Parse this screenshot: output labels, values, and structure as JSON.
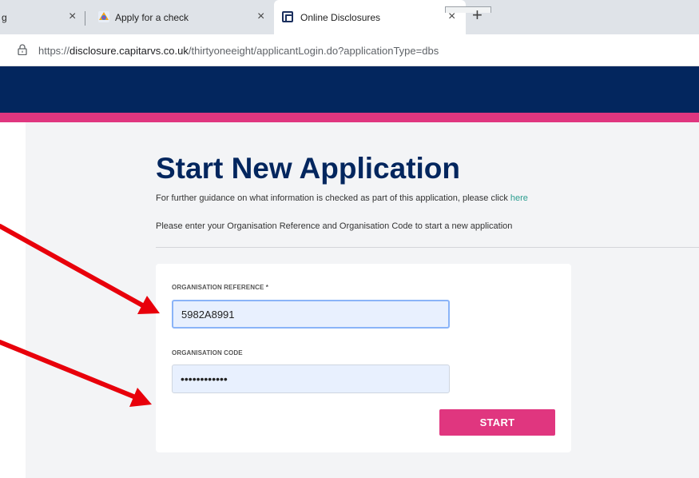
{
  "browser": {
    "tabs": [
      {
        "label": "g",
        "close": "×"
      },
      {
        "label": "Apply for a check",
        "close": "×"
      },
      {
        "label": "Online Disclosures",
        "close": "×",
        "active": true
      }
    ],
    "new_tab": "+",
    "url_prefix": "https://",
    "url_domain": "disclosure.capitarvs.co.uk",
    "url_path": "/thirtyoneeight/applicantLogin.do?applicationType=dbs"
  },
  "colors": {
    "header": "#03265e",
    "accent": "#e0367f",
    "link": "#2a9d8f",
    "annotation_arrow": "#e8000b"
  },
  "page": {
    "title": "Start New Application",
    "guidance_text": "For further guidance on what information is checked as part of this application, please click ",
    "guidance_link": "here",
    "instruction": "Please enter your Organisation Reference and Organisation Code to start a new application"
  },
  "form": {
    "org_reference_label": "ORGANISATION REFERENCE *",
    "org_reference_value": "5982A8991",
    "org_code_label": "ORGANISATION CODE",
    "org_code_value": "••••••••••••",
    "start_label": "START"
  },
  "icons": {
    "lock": "lock-icon",
    "tab_favicon_apply": "apply-favicon-icon",
    "tab_favicon_online": "capita-favicon-icon"
  }
}
